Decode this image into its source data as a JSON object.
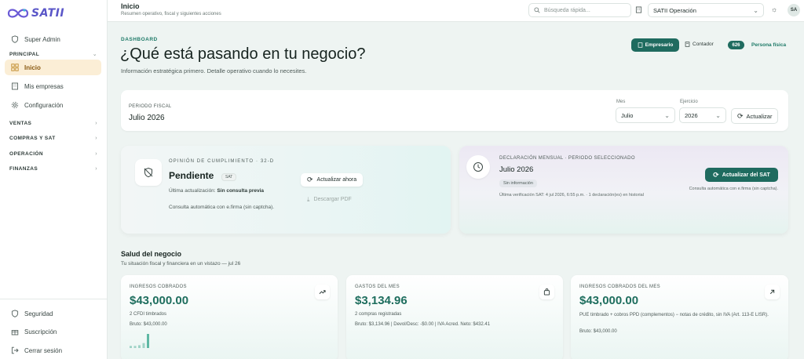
{
  "brand": {
    "logo_text": "SATII"
  },
  "sidebar": {
    "super_admin": "Super Admin",
    "sections": {
      "principal": "PRINCIPAL",
      "ventas": "VENTAS",
      "compras": "COMPRAS Y SAT",
      "operacion": "OPERACIÓN",
      "finanzas": "FINANZAS"
    },
    "items": {
      "inicio": "Inicio",
      "empresas": "Mis empresas",
      "config": "Configuración"
    },
    "footer": {
      "seguridad": "Seguridad",
      "suscripcion": "Suscripción",
      "cerrar": "Cerrar sesión"
    }
  },
  "topbar": {
    "title": "Inicio",
    "subtitle": "Resumen operativo, fiscal y siguientes acciones",
    "search_placeholder": "Búsqueda rápida...",
    "company": "SATII Operación",
    "avatar": "SA"
  },
  "dashboard": {
    "kicker": "DASHBOARD",
    "headline": "¿Qué está pasando en tu negocio?",
    "lede": "Información estratégica primero. Detalle operativo cuando lo necesites.",
    "roles": {
      "empresario": "Empresario",
      "contador": "Contador",
      "count": "626",
      "persona": "Persona física"
    }
  },
  "period": {
    "label": "PERIODO FISCAL",
    "value": "Julio 2026",
    "mes_label": "Mes",
    "mes_value": "Julio",
    "ejercicio_label": "Ejercicio",
    "ejercicio_value": "2026",
    "refresh": "Actualizar"
  },
  "opinion": {
    "kicker": "OPINIÓN DE CUMPLIMIENTO · 32-D",
    "title": "Pendiente",
    "badge": "SAT",
    "last_update_label": "Última actualización:",
    "last_update_value": "Sin consulta previa",
    "note": "Consulta automática con e.firma (sin captcha).",
    "refresh_now": "Actualizar ahora",
    "download_pdf": "Descargar PDF"
  },
  "declaracion": {
    "kicker": "DECLARACIÓN MENSUAL · PERIODO SELECCIONADO",
    "title": "Julio 2026",
    "badge": "Sin información",
    "note": "Última verificación SAT: 4 jul 2026, 6:55 p.m. · 1 declaración(es) en historial",
    "refresh_sat": "Actualizar del SAT",
    "auto": "Consulta automática con e.firma (sin captcha)."
  },
  "health": {
    "title": "Salud del negocio",
    "subtitle": "Tu situación fiscal y financiera en un vistazo — jul 26",
    "cards": [
      {
        "label": "INGRESOS COBRADOS",
        "value": "$43,000.00",
        "line1": "2 CFDI timbrados",
        "line2": "Bruto: $43,000.00",
        "icon": "trend-up-icon"
      },
      {
        "label": "GASTOS DEL MES",
        "value": "$3,134.96",
        "line1": "2 compras registradas",
        "line2": "Bruto: $3,134.96 | Devol/Desc: -$0.00 | IVA Acred. Neto: $432.41",
        "icon": "bag-icon"
      },
      {
        "label": "INGRESOS COBRADOS DEL MES",
        "value": "$43,000.00",
        "line1": "PUE timbrado + cobros PPD (complementos) − notas de crédito, sin IVA (Art. 113-E LISR).",
        "line2": "Bruto: $43,000.00",
        "icon": "arrow-up-right-icon"
      }
    ],
    "sparkline": [
      0.15,
      0.15,
      0.2,
      0.35,
      1.0
    ]
  },
  "colors": {
    "accent": "#1f6b5f",
    "active_bg": "#fbeed6",
    "money": "#1e6e5e",
    "logo": "#5a56c8"
  }
}
